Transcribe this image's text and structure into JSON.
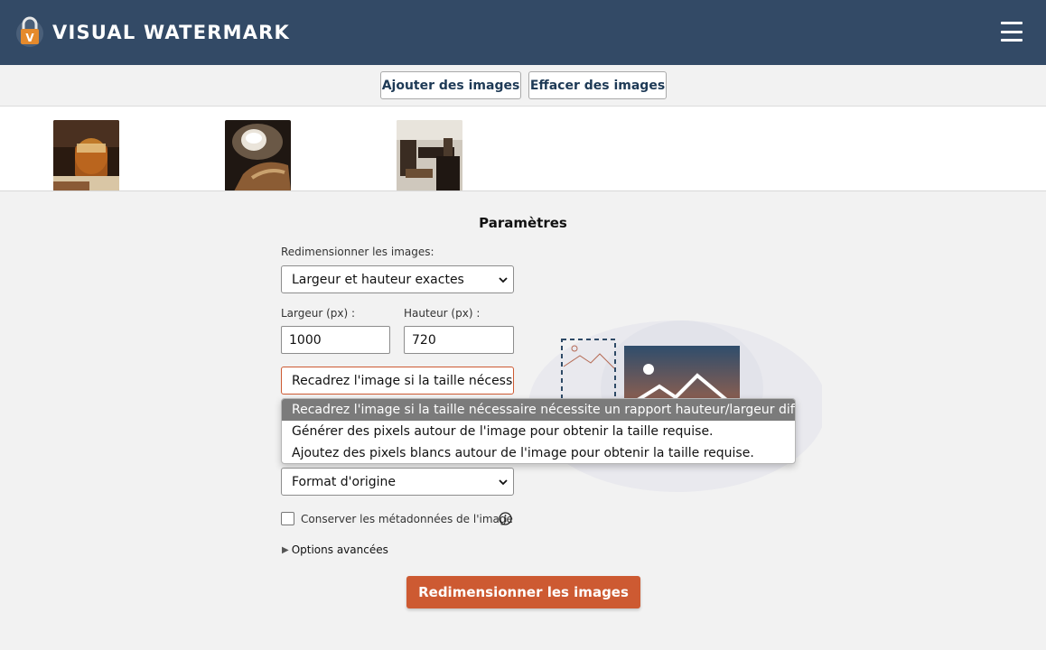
{
  "header": {
    "brand": "VISUAL WATERMARK",
    "logo_letter": "V",
    "logo_icon": "padlock-logo-icon",
    "menu_icon": "hamburger-menu-icon"
  },
  "toolbar": {
    "add_images": "Ajouter des images",
    "clear_images": "Effacer des images"
  },
  "thumbnails": [
    {
      "name": "photo-drink-glass"
    },
    {
      "name": "photo-coffee-cup"
    },
    {
      "name": "photo-cafe-table"
    }
  ],
  "settings": {
    "title": "Paramètres",
    "resize_label": "Redimensionner les images:",
    "resize_mode": "Largeur et hauteur exactes",
    "width_label": "Largeur (px) :",
    "width_value": "1000",
    "height_label": "Hauteur (px) :",
    "height_value": "720",
    "crop_mode": "Recadrez l'image si la taille nécessaire nécessite un rapport hauteur/largeur différent.",
    "crop_options": [
      "Recadrez l'image si la taille nécessaire nécessite un rapport hauteur/largeur différent.",
      "Générer des pixels autour de l'image pour obtenir la taille requise.",
      "Ajoutez des pixels blancs autour de l'image pour obtenir la taille requise."
    ],
    "format_value": "Format d'origine",
    "metadata_label": "Conserver les métadonnées de l'image",
    "metadata_checked": false,
    "advanced_label": "Options avancées",
    "submit_label": "Redimensionner les images"
  },
  "colors": {
    "header_bg": "#334a66",
    "accent": "#cd5a32",
    "button_text": "#1e3a56"
  }
}
